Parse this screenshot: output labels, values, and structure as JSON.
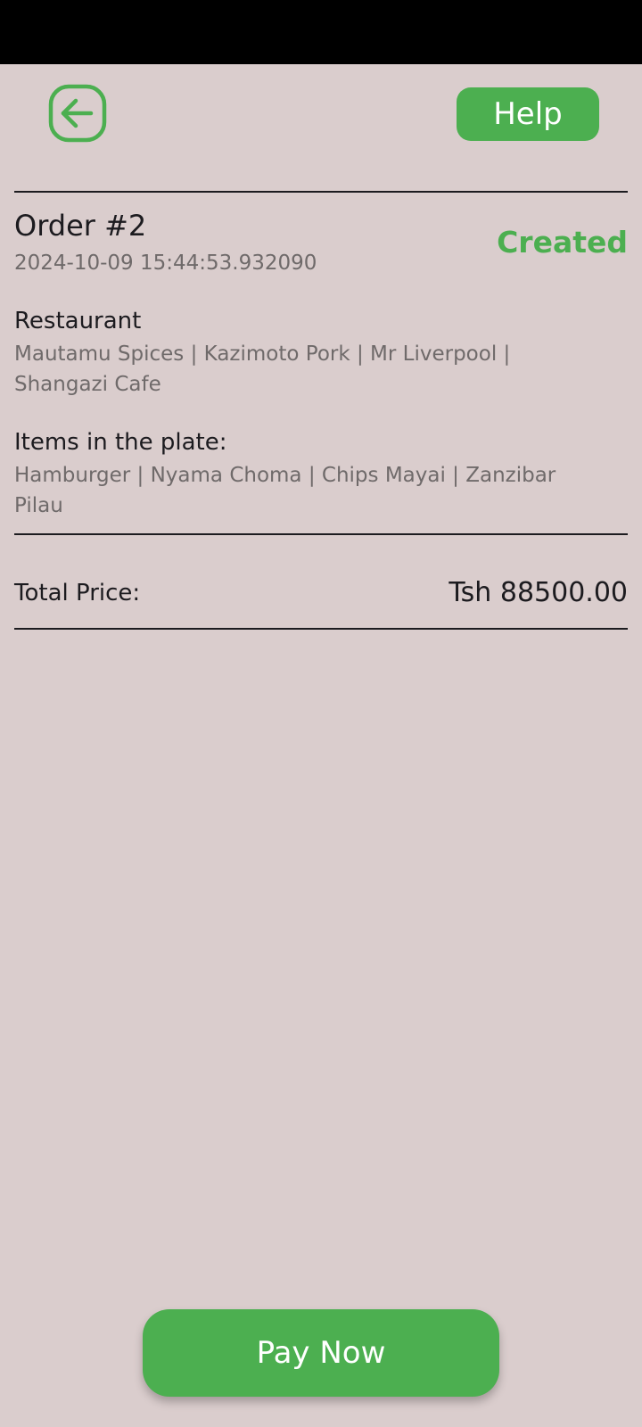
{
  "header": {
    "back_icon": "arrow-left-circle-icon",
    "help_label": "Help"
  },
  "order": {
    "title": "Order #2",
    "timestamp": "2024-10-09 15:44:53.932090",
    "status": "Created"
  },
  "restaurant": {
    "label": "Restaurant",
    "value": "Mautamu Spices | Kazimoto Pork | Mr Liverpool | Shangazi Cafe"
  },
  "items": {
    "label": "Items in the plate:",
    "value": "Hamburger | Nyama Choma | Chips Mayai | Zanzibar Pilau"
  },
  "total": {
    "label": "Total Price:",
    "value": "Tsh 88500.00"
  },
  "actions": {
    "pay_label": "Pay Now"
  },
  "colors": {
    "background": "#dacdcd",
    "accent": "#4caf50",
    "status_bar": "#000000",
    "primary_text": "#1c1b1f",
    "secondary_text": "#6f6a6a"
  }
}
